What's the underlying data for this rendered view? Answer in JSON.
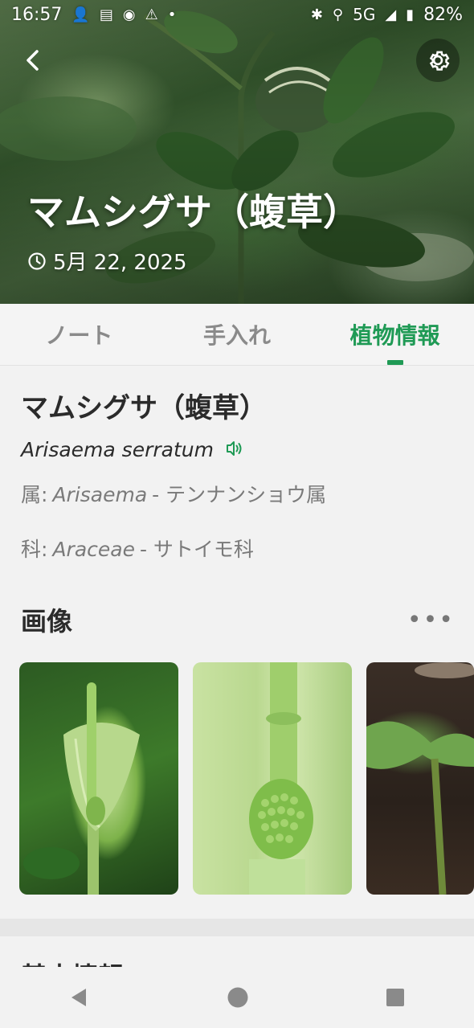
{
  "status_bar": {
    "time": "16:57",
    "network": "5G",
    "battery": "82%"
  },
  "hero": {
    "title": "マムシグサ（蝮草）",
    "date": "5月 22, 2025"
  },
  "tabs": [
    {
      "label": "ノート",
      "active": false
    },
    {
      "label": "手入れ",
      "active": false
    },
    {
      "label": "植物情報",
      "active": true
    }
  ],
  "info": {
    "name": "マムシグサ（蝮草）",
    "scientific_name": "Arisaema serratum",
    "genus_label": "属:",
    "genus_latin": "Arisaema",
    "genus_jp": "- テンナンショウ属",
    "family_label": "科:",
    "family_latin": "Araceae",
    "family_jp": "- サトイモ科"
  },
  "images_section": {
    "title": "画像",
    "more": "•••"
  },
  "basic_info": {
    "title": "基本情報"
  },
  "colors": {
    "accent": "#1f9a55"
  }
}
